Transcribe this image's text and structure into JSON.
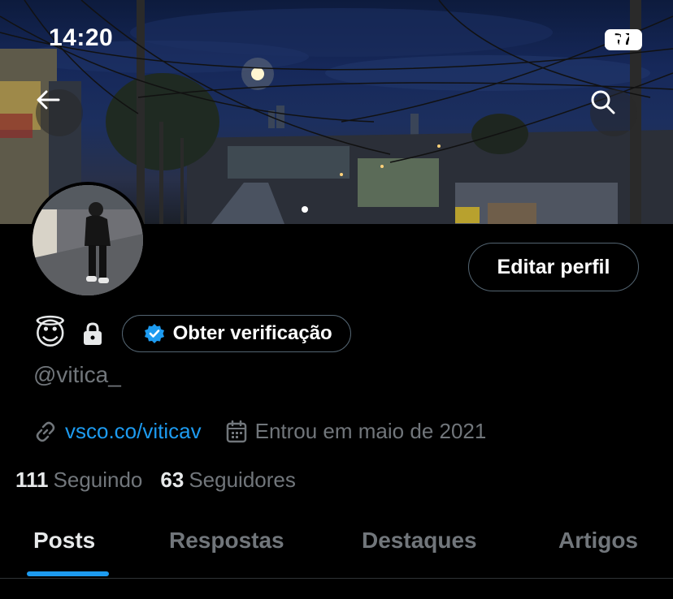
{
  "status_bar": {
    "time": "14:20",
    "battery": "77"
  },
  "banner": {
    "description_icon": "city-night-photo"
  },
  "navigation": {
    "back_icon": "back-arrow-icon",
    "search_icon": "search-icon"
  },
  "profile": {
    "emoji": "😇",
    "handle": "@vitica_",
    "edit_button": "Editar perfil",
    "verification_button": "Obter verificação",
    "website": "vsco.co/viticav",
    "joined": "Entrou em maio de 2021"
  },
  "stats": {
    "following_count": "111",
    "following_label": "Seguindo",
    "followers_count": "63",
    "followers_label": "Seguidores"
  },
  "tabs": [
    {
      "label": "Posts",
      "active": true
    },
    {
      "label": "Respostas",
      "active": false
    },
    {
      "label": "Destaques",
      "active": false
    },
    {
      "label": "Artigos",
      "active": false
    }
  ],
  "colors": {
    "accent": "#1d9bf0",
    "muted": "#71767b",
    "background": "#000000"
  }
}
